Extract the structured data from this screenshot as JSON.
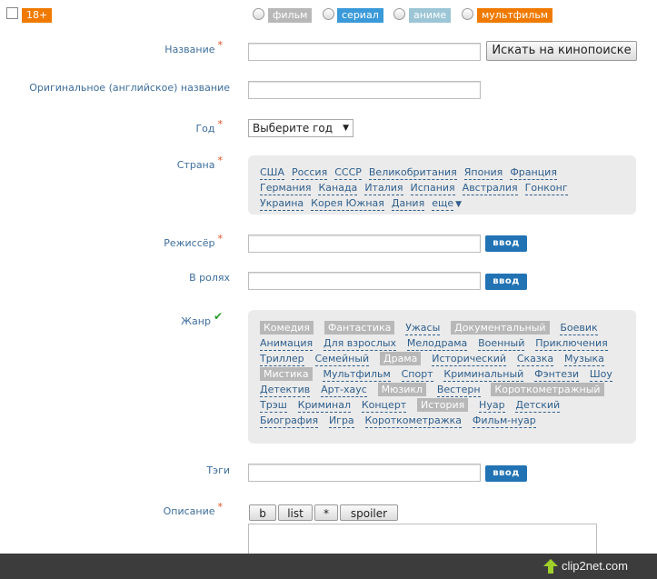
{
  "top": {
    "age_badge": "18+",
    "types": [
      {
        "label": "фильм",
        "color": "#b8b8b8"
      },
      {
        "label": "сериал",
        "color": "#3a9ad9"
      },
      {
        "label": "аниме",
        "color": "#9cc6d6"
      },
      {
        "label": "мультфильм",
        "color": "#f07a00"
      }
    ]
  },
  "form": {
    "title_label": "Название",
    "search_button": "Искать на кинопоиске",
    "orig_title_label": "Оригинальное (английское) название",
    "year_label": "Год",
    "year_select": "Выберите год",
    "country_label": "Страна",
    "countries_row1": [
      "США",
      "Россия",
      "СССР",
      "Великобритания",
      "Япония",
      "Франция"
    ],
    "countries_row2": [
      "Германия",
      "Канада",
      "Италия",
      "Испания",
      "Австралия",
      "Гонконг"
    ],
    "countries_row3": [
      "Украина",
      "Корея Южная",
      "Дания"
    ],
    "more_link": "еще",
    "director_label": "Режиссёр",
    "cast_label": "В ролях",
    "enter_button": "ввод",
    "genre_label": "Жанр",
    "genres": [
      {
        "name": "Комедия",
        "sel": true
      },
      {
        "name": "Фантастика",
        "sel": true
      },
      {
        "name": "Ужасы",
        "sel": false
      },
      {
        "name": "Документальный",
        "sel": true
      },
      {
        "name": "Боевик",
        "sel": false
      },
      {
        "name": "Анимация",
        "sel": false
      },
      {
        "name": "Для взрослых",
        "sel": false
      },
      {
        "name": "Мелодрама",
        "sel": false
      },
      {
        "name": "Военный",
        "sel": false
      },
      {
        "name": "Приключения",
        "sel": false
      },
      {
        "name": "Триллер",
        "sel": false
      },
      {
        "name": "Семейный",
        "sel": false
      },
      {
        "name": "Драма",
        "sel": true
      },
      {
        "name": "Исторический",
        "sel": false
      },
      {
        "name": "Сказка",
        "sel": false
      },
      {
        "name": "Музыка",
        "sel": false
      },
      {
        "name": "Мистика",
        "sel": true
      },
      {
        "name": "Мультфильм",
        "sel": false
      },
      {
        "name": "Спорт",
        "sel": false
      },
      {
        "name": "Криминальный",
        "sel": false
      },
      {
        "name": "Фэнтези",
        "sel": false
      },
      {
        "name": "Шоу",
        "sel": false
      },
      {
        "name": "Детектив",
        "sel": false
      },
      {
        "name": "Арт-хаус",
        "sel": false
      },
      {
        "name": "Мюзикл",
        "sel": true
      },
      {
        "name": "Вестерн",
        "sel": false
      },
      {
        "name": "Короткометражный",
        "sel": true
      },
      {
        "name": "Трэш",
        "sel": false
      },
      {
        "name": "Криминал",
        "sel": false
      },
      {
        "name": "Концерт",
        "sel": false
      },
      {
        "name": "История",
        "sel": true
      },
      {
        "name": "Нуар",
        "sel": false
      },
      {
        "name": "Детский",
        "sel": false
      },
      {
        "name": "Биография",
        "sel": false
      },
      {
        "name": "Игра",
        "sel": false
      },
      {
        "name": "Короткометражка",
        "sel": false
      },
      {
        "name": "Фильм-нуар",
        "sel": false
      }
    ],
    "tags_label": "Тэги",
    "description_label": "Описание",
    "format_buttons": [
      "b",
      "list",
      "*",
      "spoiler"
    ],
    "required_mark": "*",
    "check_mark": "✔"
  },
  "footer": {
    "brand": "clip2net.com"
  }
}
